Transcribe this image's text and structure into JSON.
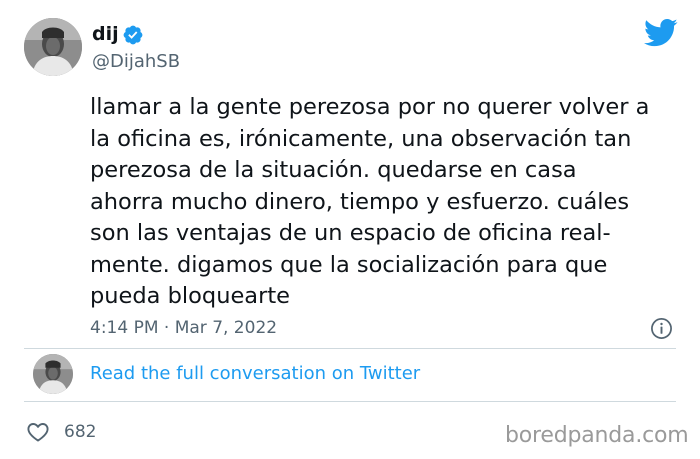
{
  "tweet": {
    "author": {
      "display_name": "dij",
      "handle": "@DijahSB",
      "verified": true,
      "avatar_icon": "profile-photo"
    },
    "text_lines": [
      "llamar a la gente perezosa por no querer volver a",
      "la oficina es, irónicamente, una observación tan",
      "perezosa de la situación. quedarse en casa",
      "ahorra mucho dinero, tiempo y esfuerzo. cuáles",
      "son las ventajas de un espacio de oficina real-",
      "mente. digamos que la socialización para que",
      "pueda bloquearte"
    ],
    "timestamp": "4:14 PM · Mar 7, 2022",
    "conversation_link": "Read the full conversation on Twitter",
    "like_count": "682"
  },
  "icons": {
    "brand": "twitter-bird-icon",
    "verified": "verified-badge-icon",
    "info": "info-icon",
    "like": "heart-icon"
  },
  "watermark": "boredpanda.com",
  "colors": {
    "brand_blue": "#1d9bf0",
    "text": "#0f1419",
    "secondary_text": "#536471",
    "divider": "#cfd9de",
    "watermark": "#9a9a9a"
  }
}
